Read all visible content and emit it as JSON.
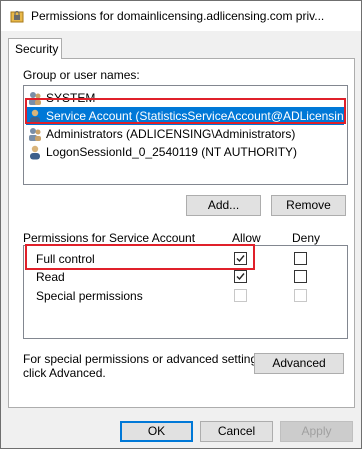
{
  "window": {
    "title": "Permissions for domainlicensing.adlicensing.com priv..."
  },
  "tabs": [
    {
      "label": "Security"
    }
  ],
  "group_section": {
    "label": "Group or user names:",
    "items": [
      {
        "label": "SYSTEM",
        "icon": "users-icon",
        "selected": false
      },
      {
        "label": "Service Account (StatisticsServiceAccount@ADLicensing.c...",
        "icon": "user-icon",
        "selected": true
      },
      {
        "label": "Administrators (ADLICENSING\\Administrators)",
        "icon": "users-icon",
        "selected": false
      },
      {
        "label": "LogonSessionId_0_2540119 (NT AUTHORITY)",
        "icon": "user-icon",
        "selected": false
      }
    ],
    "add_button": "Add...",
    "remove_button": "Remove"
  },
  "permissions_section": {
    "header_label": "Permissions for Service Account",
    "allow_header": "Allow",
    "deny_header": "Deny",
    "rows": [
      {
        "label": "Full control",
        "allow": true,
        "allow_enabled": true,
        "deny": false,
        "deny_enabled": true
      },
      {
        "label": "Read",
        "allow": true,
        "allow_enabled": true,
        "deny": false,
        "deny_enabled": true
      },
      {
        "label": "Special permissions",
        "allow": false,
        "allow_enabled": false,
        "deny": false,
        "deny_enabled": false
      }
    ]
  },
  "advanced_section": {
    "text_line1": "For special permissions or advanced settings,",
    "text_line2": "click Advanced.",
    "button": "Advanced"
  },
  "footer": {
    "ok": "OK",
    "cancel": "Cancel",
    "apply": "Apply"
  },
  "colors": {
    "selection": "#0078d7",
    "highlight_box": "#e0202a"
  }
}
